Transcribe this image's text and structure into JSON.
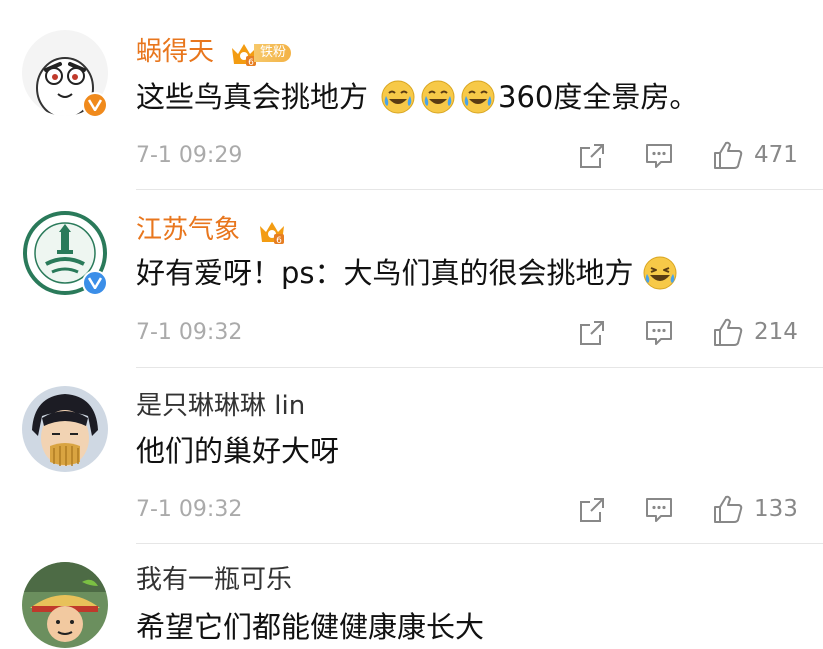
{
  "comments": [
    {
      "username": "蜗得天",
      "fan_badge": "铁粉",
      "level": "6",
      "text": "这些鸟真会挑地方",
      "text_suffix": "360度全景房。",
      "emojis": [
        "laugh-cry-emoji",
        "laugh-cry-emoji",
        "laugh-cry-emoji"
      ],
      "timestamp": "7-1 09:29",
      "likes": "471",
      "verified": "orange-v"
    },
    {
      "username": "江苏气象",
      "level": "6",
      "text": "好有爱呀！ps：大鸟们真的很会挑地方",
      "emojis": [
        "laugh-emoji"
      ],
      "timestamp": "7-1 09:32",
      "likes": "214",
      "verified": "blue-v"
    },
    {
      "username": "是只琳琳琳 lin",
      "text": "他们的巢好大呀",
      "timestamp": "7-1 09:32",
      "likes": "133"
    },
    {
      "username": "我有一瓶可乐",
      "text": "希望它们都能健健康康长大"
    }
  ],
  "colors": {
    "vip_name": "#e8761d",
    "normal_name": "#333333",
    "timestamp": "#aaaaaa",
    "icon": "#888888",
    "verified_blue": "#3b8ee8",
    "verified_orange": "#f08a1c"
  }
}
